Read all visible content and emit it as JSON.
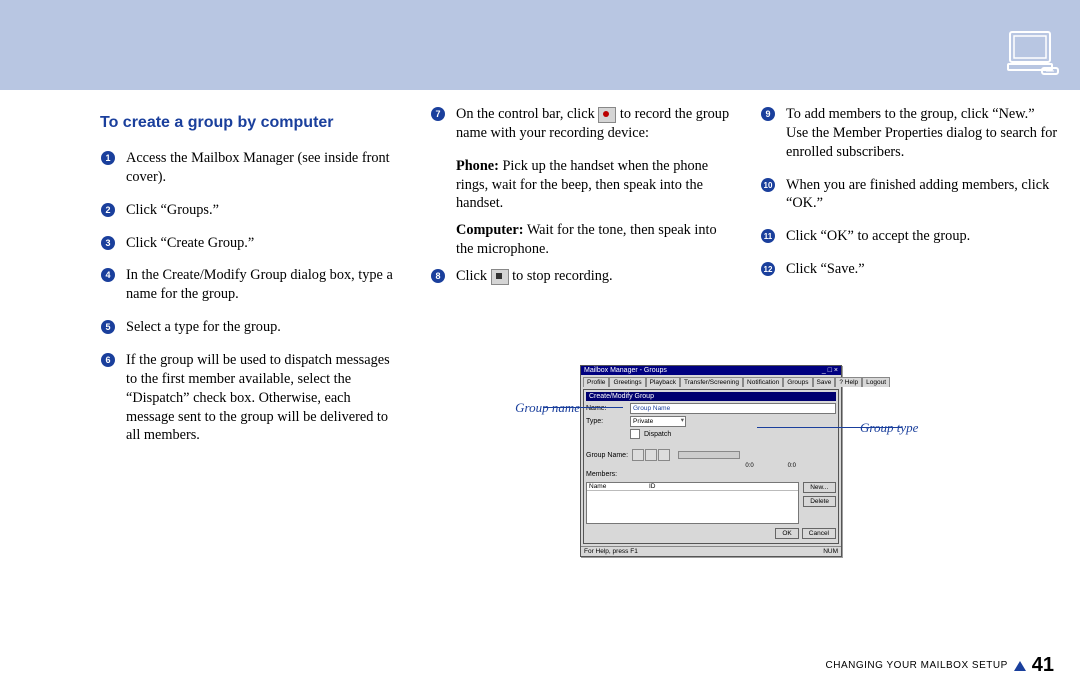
{
  "header": {
    "icon": "computer-monitor-icon"
  },
  "section_title": "To create a group by computer",
  "steps": {
    "s1": "Access the Mailbox Manager (see inside front cover).",
    "s2": "Click “Groups.”",
    "s3": "Click “Create Group.”",
    "s4": "In the Create/Modify Group dialog box, type a name for the group.",
    "s5": "Select a type for the group.",
    "s6": "If the group will be used to dispatch messages to the first member available, select the “Dispatch” check box. Otherwise, each message sent to the group will be delivered to all members.",
    "s7a": "On the control bar, click ",
    "s7b": " to record the group name with your recording device:",
    "s7_phone_label": "Phone:",
    "s7_phone": " Pick up the handset when the phone rings, wait for the beep, then speak into the handset.",
    "s7_comp_label": "Computer:",
    "s7_comp": " Wait for the tone, then speak into the microphone.",
    "s8a": "Click ",
    "s8b": " to stop recording.",
    "s9": "To add members to the group, click “New.” Use the Member Properties dialog to search for enrolled subscribers.",
    "s10": "When you are finished adding members, click “OK.”",
    "s11": "Click “OK” to accept the group.",
    "s12": "Click “Save.”"
  },
  "callouts": {
    "group_name": "Group name",
    "group_type": "Group type"
  },
  "dialog": {
    "title": "Mailbox Manager - Groups",
    "tabs": [
      "Profile",
      "Greetings",
      "Playback",
      "Transfer/Screening",
      "Notification",
      "Groups",
      "Save",
      "? Help",
      "Logout"
    ],
    "inner_title": "Create/Modify Group",
    "name_label": "Name:",
    "name_value": "Group Name",
    "type_label": "Type:",
    "type_value": "Private",
    "dispatch_label": "Dispatch",
    "groupname2_label": "Group Name:",
    "time1": "0:0",
    "time2": "0:0",
    "members_label": "Members:",
    "col_name": "Name",
    "col_id": "ID",
    "btn_new": "New...",
    "btn_delete": "Delete",
    "btn_ok": "OK",
    "btn_cancel": "Cancel",
    "status": "For Help, press F1",
    "status_num": "NUM"
  },
  "footer": {
    "section": "CHANGING YOUR MAILBOX SETUP",
    "page": "41"
  }
}
